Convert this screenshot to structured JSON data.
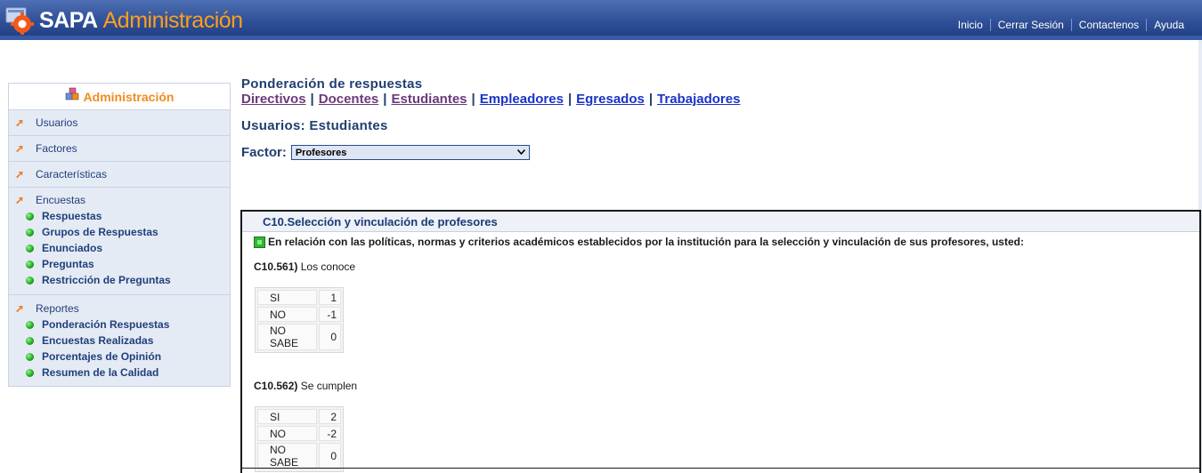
{
  "app": {
    "title_main": "SAPA",
    "title_sub": "Administración"
  },
  "topnav": [
    "Inicio",
    "Cerrar Sesión",
    "Contactenos",
    "Ayuda"
  ],
  "sidebar": {
    "header": "Administración",
    "sections": [
      {
        "label": "Usuarios",
        "items": []
      },
      {
        "label": "Factores",
        "items": []
      },
      {
        "label": "Características",
        "items": []
      },
      {
        "label": "Encuestas",
        "items": [
          "Respuestas",
          "Grupos de Respuestas",
          "Enunciados",
          "Preguntas",
          "Restricción de Preguntas"
        ]
      },
      {
        "label": "Reportes",
        "items": [
          "Ponderación Respuestas",
          "Encuestas Realizadas",
          "Porcentajes de Opinión",
          "Resumen de la Calidad"
        ]
      }
    ]
  },
  "main": {
    "title": "Ponderación de respuestas",
    "user_links": [
      "Directivos",
      "Docentes",
      "Estudiantes",
      "Empleadores",
      "Egresados",
      "Trabajadores"
    ],
    "separator": "|",
    "usuarios_label": "Usuarios: Estudiantes",
    "factor_label": "Factor:",
    "factor_selected": "Profesores"
  },
  "panel": {
    "heading": "C10.Selección y vinculación de profesores",
    "intro": "En relación con las políticas, normas y criterios académicos establecidos por la institución para la selección y vinculación de sus profesores, usted:",
    "questions": [
      {
        "code": "C10.561)",
        "text": "Los conoce",
        "answers": [
          {
            "option": "SI",
            "value": "1"
          },
          {
            "option": "NO",
            "value": "-1"
          },
          {
            "option": "NO SABE",
            "value": "0"
          }
        ]
      },
      {
        "code": "C10.562)",
        "text": "Se cumplen",
        "answers": [
          {
            "option": "SI",
            "value": "2"
          },
          {
            "option": "NO",
            "value": "-2"
          },
          {
            "option": "NO SABE",
            "value": "0"
          }
        ]
      }
    ]
  },
  "colors": {
    "header_blue": "#2f4f96",
    "accent_orange": "#ff9f1c",
    "link_blue": "#1a33c7",
    "visited_purple": "#6b3a7a",
    "sidebar_bg": "#e4ebf5"
  }
}
